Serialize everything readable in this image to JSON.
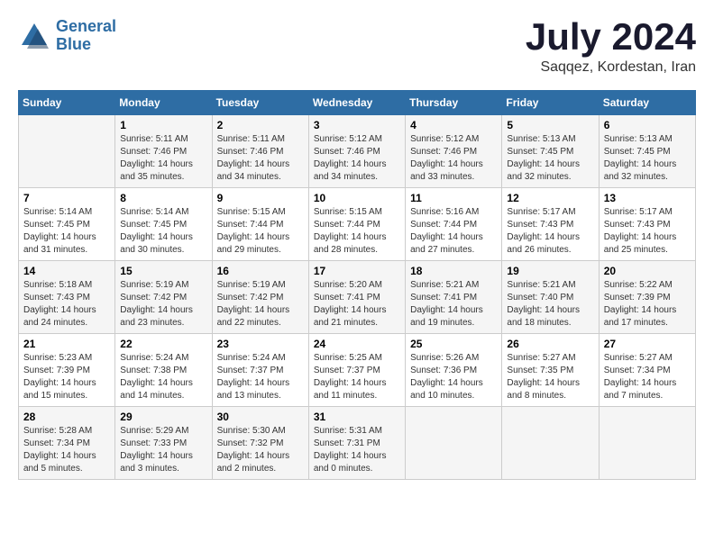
{
  "header": {
    "logo_line1": "General",
    "logo_line2": "Blue",
    "month_year": "July 2024",
    "location": "Saqqez, Kordestan, Iran"
  },
  "weekdays": [
    "Sunday",
    "Monday",
    "Tuesday",
    "Wednesday",
    "Thursday",
    "Friday",
    "Saturday"
  ],
  "weeks": [
    [
      {
        "day": "",
        "info": ""
      },
      {
        "day": "1",
        "info": "Sunrise: 5:11 AM\nSunset: 7:46 PM\nDaylight: 14 hours\nand 35 minutes."
      },
      {
        "day": "2",
        "info": "Sunrise: 5:11 AM\nSunset: 7:46 PM\nDaylight: 14 hours\nand 34 minutes."
      },
      {
        "day": "3",
        "info": "Sunrise: 5:12 AM\nSunset: 7:46 PM\nDaylight: 14 hours\nand 34 minutes."
      },
      {
        "day": "4",
        "info": "Sunrise: 5:12 AM\nSunset: 7:46 PM\nDaylight: 14 hours\nand 33 minutes."
      },
      {
        "day": "5",
        "info": "Sunrise: 5:13 AM\nSunset: 7:45 PM\nDaylight: 14 hours\nand 32 minutes."
      },
      {
        "day": "6",
        "info": "Sunrise: 5:13 AM\nSunset: 7:45 PM\nDaylight: 14 hours\nand 32 minutes."
      }
    ],
    [
      {
        "day": "7",
        "info": "Sunrise: 5:14 AM\nSunset: 7:45 PM\nDaylight: 14 hours\nand 31 minutes."
      },
      {
        "day": "8",
        "info": "Sunrise: 5:14 AM\nSunset: 7:45 PM\nDaylight: 14 hours\nand 30 minutes."
      },
      {
        "day": "9",
        "info": "Sunrise: 5:15 AM\nSunset: 7:44 PM\nDaylight: 14 hours\nand 29 minutes."
      },
      {
        "day": "10",
        "info": "Sunrise: 5:15 AM\nSunset: 7:44 PM\nDaylight: 14 hours\nand 28 minutes."
      },
      {
        "day": "11",
        "info": "Sunrise: 5:16 AM\nSunset: 7:44 PM\nDaylight: 14 hours\nand 27 minutes."
      },
      {
        "day": "12",
        "info": "Sunrise: 5:17 AM\nSunset: 7:43 PM\nDaylight: 14 hours\nand 26 minutes."
      },
      {
        "day": "13",
        "info": "Sunrise: 5:17 AM\nSunset: 7:43 PM\nDaylight: 14 hours\nand 25 minutes."
      }
    ],
    [
      {
        "day": "14",
        "info": "Sunrise: 5:18 AM\nSunset: 7:43 PM\nDaylight: 14 hours\nand 24 minutes."
      },
      {
        "day": "15",
        "info": "Sunrise: 5:19 AM\nSunset: 7:42 PM\nDaylight: 14 hours\nand 23 minutes."
      },
      {
        "day": "16",
        "info": "Sunrise: 5:19 AM\nSunset: 7:42 PM\nDaylight: 14 hours\nand 22 minutes."
      },
      {
        "day": "17",
        "info": "Sunrise: 5:20 AM\nSunset: 7:41 PM\nDaylight: 14 hours\nand 21 minutes."
      },
      {
        "day": "18",
        "info": "Sunrise: 5:21 AM\nSunset: 7:41 PM\nDaylight: 14 hours\nand 19 minutes."
      },
      {
        "day": "19",
        "info": "Sunrise: 5:21 AM\nSunset: 7:40 PM\nDaylight: 14 hours\nand 18 minutes."
      },
      {
        "day": "20",
        "info": "Sunrise: 5:22 AM\nSunset: 7:39 PM\nDaylight: 14 hours\nand 17 minutes."
      }
    ],
    [
      {
        "day": "21",
        "info": "Sunrise: 5:23 AM\nSunset: 7:39 PM\nDaylight: 14 hours\nand 15 minutes."
      },
      {
        "day": "22",
        "info": "Sunrise: 5:24 AM\nSunset: 7:38 PM\nDaylight: 14 hours\nand 14 minutes."
      },
      {
        "day": "23",
        "info": "Sunrise: 5:24 AM\nSunset: 7:37 PM\nDaylight: 14 hours\nand 13 minutes."
      },
      {
        "day": "24",
        "info": "Sunrise: 5:25 AM\nSunset: 7:37 PM\nDaylight: 14 hours\nand 11 minutes."
      },
      {
        "day": "25",
        "info": "Sunrise: 5:26 AM\nSunset: 7:36 PM\nDaylight: 14 hours\nand 10 minutes."
      },
      {
        "day": "26",
        "info": "Sunrise: 5:27 AM\nSunset: 7:35 PM\nDaylight: 14 hours\nand 8 minutes."
      },
      {
        "day": "27",
        "info": "Sunrise: 5:27 AM\nSunset: 7:34 PM\nDaylight: 14 hours\nand 7 minutes."
      }
    ],
    [
      {
        "day": "28",
        "info": "Sunrise: 5:28 AM\nSunset: 7:34 PM\nDaylight: 14 hours\nand 5 minutes."
      },
      {
        "day": "29",
        "info": "Sunrise: 5:29 AM\nSunset: 7:33 PM\nDaylight: 14 hours\nand 3 minutes."
      },
      {
        "day": "30",
        "info": "Sunrise: 5:30 AM\nSunset: 7:32 PM\nDaylight: 14 hours\nand 2 minutes."
      },
      {
        "day": "31",
        "info": "Sunrise: 5:31 AM\nSunset: 7:31 PM\nDaylight: 14 hours\nand 0 minutes."
      },
      {
        "day": "",
        "info": ""
      },
      {
        "day": "",
        "info": ""
      },
      {
        "day": "",
        "info": ""
      }
    ]
  ]
}
